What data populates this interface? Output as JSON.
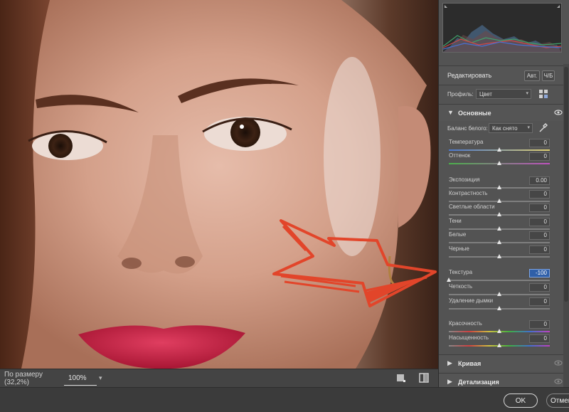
{
  "panel": {
    "edit_title": "Редактировать",
    "auto_label": "Авт.",
    "bw_label": "Ч/Б",
    "profile_label": "Профиль:",
    "profile_value": "Цвет",
    "wb_label": "Баланс белого:",
    "wb_value": "Как снято",
    "sections": {
      "basic": "Основные",
      "curve": "Кривая",
      "detail": "Детализация"
    },
    "sliders": [
      {
        "label": "Температура",
        "value": "0",
        "pos": 0.5,
        "track": "temp"
      },
      {
        "label": "Оттенок",
        "value": "0",
        "pos": 0.5,
        "track": "tint"
      },
      {
        "label": "Экспозиция",
        "value": "0.00",
        "pos": 0.5,
        "track": "gray"
      },
      {
        "label": "Контрастность",
        "value": "0",
        "pos": 0.5,
        "track": "gray"
      },
      {
        "label": "Светлые области",
        "value": "0",
        "pos": 0.5,
        "track": "gray"
      },
      {
        "label": "Тени",
        "value": "0",
        "pos": 0.5,
        "track": "gray"
      },
      {
        "label": "Белые",
        "value": "0",
        "pos": 0.5,
        "track": "gray"
      },
      {
        "label": "Черные",
        "value": "0",
        "pos": 0.5,
        "track": "gray"
      },
      {
        "label": "Текстура",
        "value": "-100",
        "pos": 0.0,
        "track": "gray",
        "active": true
      },
      {
        "label": "Четкость",
        "value": "0",
        "pos": 0.5,
        "track": "gray"
      },
      {
        "label": "Удаление дымки",
        "value": "0",
        "pos": 0.5,
        "track": "gray"
      },
      {
        "label": "Красочность",
        "value": "0",
        "pos": 0.5,
        "track": "sat"
      },
      {
        "label": "Насыщенность",
        "value": "0",
        "pos": 0.5,
        "track": "sat"
      }
    ]
  },
  "bottombar": {
    "zoom_fit_label": "По размеру (32,2%)",
    "zoom_value": "100%"
  },
  "footer": {
    "ok_label": "OK",
    "cancel_label": "Отмена"
  },
  "colors": {
    "accent_active": "#2f5fa8",
    "annotation_arrow": "#e2452a",
    "lip_color": "#c21f3f"
  }
}
